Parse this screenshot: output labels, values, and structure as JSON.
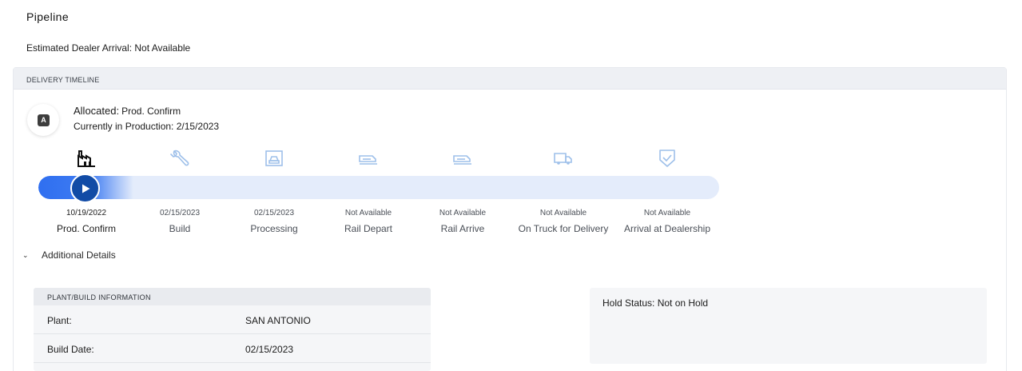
{
  "page": {
    "title": "Pipeline",
    "estimated_arrival": "Estimated Dealer Arrival: Not Available"
  },
  "timeline": {
    "header": "DELIVERY TIMELINE",
    "badge_letter": "A",
    "status_label": "Allocated:",
    "status_detail": "Prod. Confirm",
    "production_line": "Currently in Production: 2/15/2023",
    "progress_fraction": 0.14,
    "accent_color": "#2f6ff0",
    "play_button_color": "#114ba6",
    "stages": [
      {
        "icon": "factory-icon",
        "date": "10/19/2022",
        "label": "Prod. Confirm"
      },
      {
        "icon": "wrench-icon",
        "date": "02/15/2023",
        "label": "Build"
      },
      {
        "icon": "processing-icon",
        "date": "02/15/2023",
        "label": "Processing"
      },
      {
        "icon": "rail-depart-icon",
        "date": "Not Available",
        "label": "Rail Depart"
      },
      {
        "icon": "rail-arrive-icon",
        "date": "Not Available",
        "label": "Rail Arrive"
      },
      {
        "icon": "truck-icon",
        "date": "Not Available",
        "label": "On Truck for Delivery"
      },
      {
        "icon": "shield-check-icon",
        "date": "Not Available",
        "label": "Arrival at Dealership"
      }
    ]
  },
  "details": {
    "toggle_label": "Additional Details",
    "plant": {
      "header": "PLANT/BUILD INFORMATION",
      "rows": [
        {
          "key": "Plant:",
          "value": "SAN ANTONIO"
        },
        {
          "key": "Build Date:",
          "value": "02/15/2023"
        }
      ]
    },
    "hold_status": "Hold Status: Not on Hold"
  }
}
